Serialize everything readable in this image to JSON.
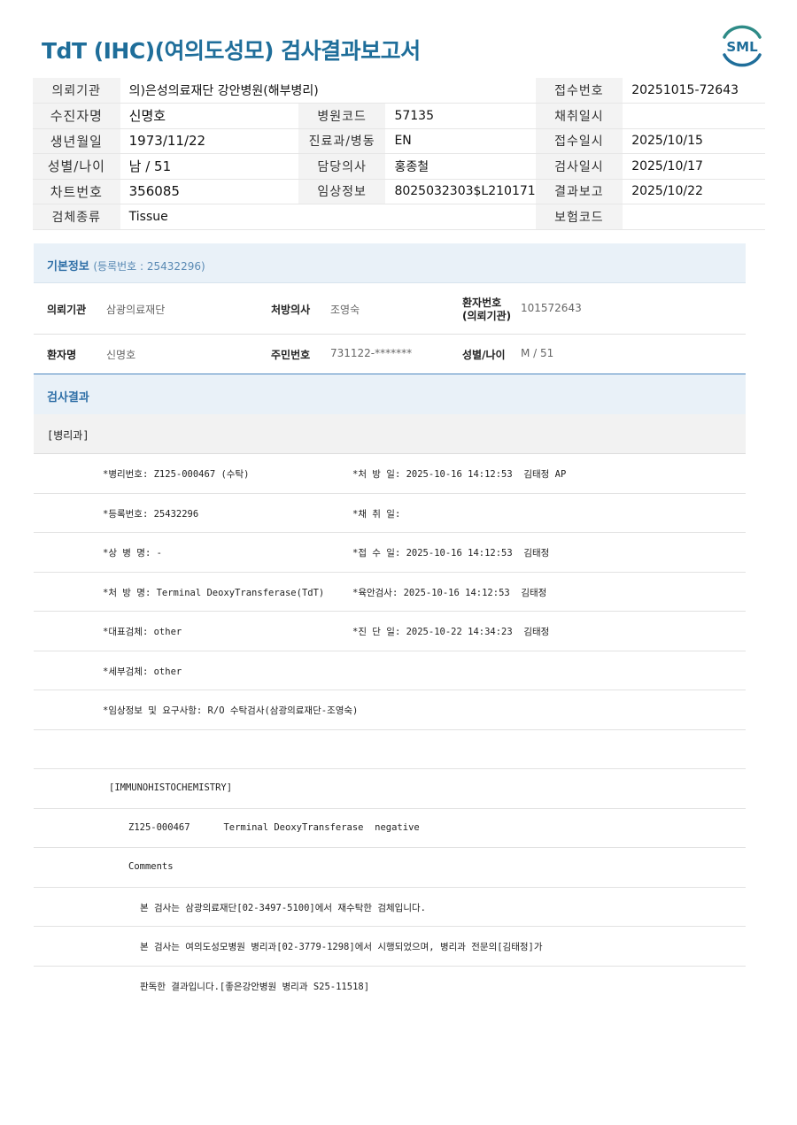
{
  "title": "TdT (IHC)(여의도성모) 검사결과보고서",
  "logo_text": "SML",
  "header": {
    "rows": [
      [
        {
          "label": "의뢰기관",
          "value": "의)은성의료재단 강안병원(해부병리)"
        },
        {
          "label": "접수번호",
          "value": "20251015-72643"
        }
      ],
      [
        {
          "label": "수진자명",
          "value": "신명호"
        },
        {
          "label": "병원코드",
          "value": "57135"
        },
        {
          "label": "채취일시",
          "value": ""
        }
      ],
      [
        {
          "label": "생년월일",
          "value": "1973/11/22"
        },
        {
          "label": "진료과/병동",
          "value": "EN"
        },
        {
          "label": "접수일시",
          "value": "2025/10/15"
        }
      ],
      [
        {
          "label": "성별/나이",
          "value": "남 / 51"
        },
        {
          "label": "담당의사",
          "value": "홍종철"
        },
        {
          "label": "검사일시",
          "value": "2025/10/17"
        }
      ],
      [
        {
          "label": "차트번호",
          "value": "356085"
        },
        {
          "label": "임상정보",
          "value": "8025032303$L210171"
        },
        {
          "label": "결과보고",
          "value": "2025/10/22"
        }
      ],
      [
        {
          "label": "검체종류",
          "value": "Tissue"
        },
        {
          "label": "보험코드",
          "value": ""
        }
      ]
    ]
  },
  "basic": {
    "heading": "기본정보",
    "sub": "(등록번호 : 25432296)",
    "client_label": "의뢰기관",
    "client_value": "삼광의료재단",
    "doctor_label": "처방의사",
    "doctor_value": "조영숙",
    "patno_label_1": "환자번호",
    "patno_label_2": "(의뢰기관)",
    "patno_value": "101572643",
    "name_label": "환자명",
    "name_value": "신명호",
    "rrn_label": "주민번호",
    "rrn_value": "731122-*******",
    "sex_label": "성별/나이",
    "sex_value": "M / 51"
  },
  "result": {
    "heading": "검사결과",
    "dept": "[병리과]",
    "lines": [
      {
        "left": "*병리번호: Z125-000467 (수탁)",
        "right": "*처 방 일: 2025-10-16 14:12:53  김태정 AP"
      },
      {
        "left": "*등록번호: 25432296",
        "right": "*채 취 일:"
      },
      {
        "left": "*상 병 명: -",
        "right": "*접 수 일: 2025-10-16 14:12:53  김태정"
      },
      {
        "left": "*처 방 명: Terminal DeoxyTransferase(TdT)",
        "right": "*육안검사: 2025-10-16 14:12:53  김태정"
      },
      {
        "left": "*대표검체: other",
        "right": "*진 단 일: 2025-10-22 14:34:23  김태정"
      },
      {
        "left": "*세부검체: other",
        "right": ""
      },
      {
        "left": "*임상정보 및 요구사항: R/O 수탁검사(삼광의료재단-조영숙)",
        "right": ""
      }
    ],
    "ihc_title": "[IMMUNOHISTOCHEMISTRY]",
    "ihc_line": "Z125-000467      Terminal DeoxyTransferase  negative",
    "comments_label": "Comments",
    "comment_1": "본 검사는 삼광의료재단[02-3497-5100]에서 재수탁한 검체입니다.",
    "comment_2": "본 검사는 여의도성모병원 병리과[02-3779-1298]에서 시행되었으며, 병리과 전문의[김태정]가",
    "comment_3": "판독한 결과입니다.[좋은강안병원 병리과 S25-11518]"
  }
}
